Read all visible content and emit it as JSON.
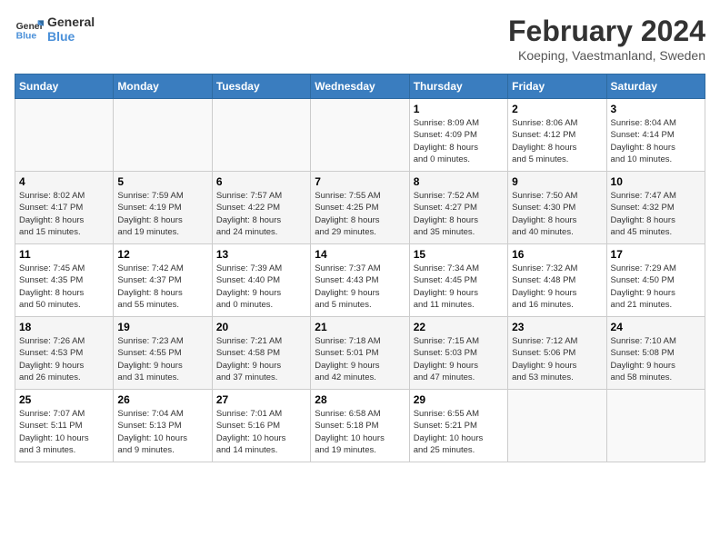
{
  "logo": {
    "text_general": "General",
    "text_blue": "Blue"
  },
  "title": "February 2024",
  "subtitle": "Koeping, Vaestmanland, Sweden",
  "weekdays": [
    "Sunday",
    "Monday",
    "Tuesday",
    "Wednesday",
    "Thursday",
    "Friday",
    "Saturday"
  ],
  "weeks": [
    [
      {
        "day": null,
        "info": null
      },
      {
        "day": null,
        "info": null
      },
      {
        "day": null,
        "info": null
      },
      {
        "day": null,
        "info": null
      },
      {
        "day": "1",
        "info": "Sunrise: 8:09 AM\nSunset: 4:09 PM\nDaylight: 8 hours\nand 0 minutes."
      },
      {
        "day": "2",
        "info": "Sunrise: 8:06 AM\nSunset: 4:12 PM\nDaylight: 8 hours\nand 5 minutes."
      },
      {
        "day": "3",
        "info": "Sunrise: 8:04 AM\nSunset: 4:14 PM\nDaylight: 8 hours\nand 10 minutes."
      }
    ],
    [
      {
        "day": "4",
        "info": "Sunrise: 8:02 AM\nSunset: 4:17 PM\nDaylight: 8 hours\nand 15 minutes."
      },
      {
        "day": "5",
        "info": "Sunrise: 7:59 AM\nSunset: 4:19 PM\nDaylight: 8 hours\nand 19 minutes."
      },
      {
        "day": "6",
        "info": "Sunrise: 7:57 AM\nSunset: 4:22 PM\nDaylight: 8 hours\nand 24 minutes."
      },
      {
        "day": "7",
        "info": "Sunrise: 7:55 AM\nSunset: 4:25 PM\nDaylight: 8 hours\nand 29 minutes."
      },
      {
        "day": "8",
        "info": "Sunrise: 7:52 AM\nSunset: 4:27 PM\nDaylight: 8 hours\nand 35 minutes."
      },
      {
        "day": "9",
        "info": "Sunrise: 7:50 AM\nSunset: 4:30 PM\nDaylight: 8 hours\nand 40 minutes."
      },
      {
        "day": "10",
        "info": "Sunrise: 7:47 AM\nSunset: 4:32 PM\nDaylight: 8 hours\nand 45 minutes."
      }
    ],
    [
      {
        "day": "11",
        "info": "Sunrise: 7:45 AM\nSunset: 4:35 PM\nDaylight: 8 hours\nand 50 minutes."
      },
      {
        "day": "12",
        "info": "Sunrise: 7:42 AM\nSunset: 4:37 PM\nDaylight: 8 hours\nand 55 minutes."
      },
      {
        "day": "13",
        "info": "Sunrise: 7:39 AM\nSunset: 4:40 PM\nDaylight: 9 hours\nand 0 minutes."
      },
      {
        "day": "14",
        "info": "Sunrise: 7:37 AM\nSunset: 4:43 PM\nDaylight: 9 hours\nand 5 minutes."
      },
      {
        "day": "15",
        "info": "Sunrise: 7:34 AM\nSunset: 4:45 PM\nDaylight: 9 hours\nand 11 minutes."
      },
      {
        "day": "16",
        "info": "Sunrise: 7:32 AM\nSunset: 4:48 PM\nDaylight: 9 hours\nand 16 minutes."
      },
      {
        "day": "17",
        "info": "Sunrise: 7:29 AM\nSunset: 4:50 PM\nDaylight: 9 hours\nand 21 minutes."
      }
    ],
    [
      {
        "day": "18",
        "info": "Sunrise: 7:26 AM\nSunset: 4:53 PM\nDaylight: 9 hours\nand 26 minutes."
      },
      {
        "day": "19",
        "info": "Sunrise: 7:23 AM\nSunset: 4:55 PM\nDaylight: 9 hours\nand 31 minutes."
      },
      {
        "day": "20",
        "info": "Sunrise: 7:21 AM\nSunset: 4:58 PM\nDaylight: 9 hours\nand 37 minutes."
      },
      {
        "day": "21",
        "info": "Sunrise: 7:18 AM\nSunset: 5:01 PM\nDaylight: 9 hours\nand 42 minutes."
      },
      {
        "day": "22",
        "info": "Sunrise: 7:15 AM\nSunset: 5:03 PM\nDaylight: 9 hours\nand 47 minutes."
      },
      {
        "day": "23",
        "info": "Sunrise: 7:12 AM\nSunset: 5:06 PM\nDaylight: 9 hours\nand 53 minutes."
      },
      {
        "day": "24",
        "info": "Sunrise: 7:10 AM\nSunset: 5:08 PM\nDaylight: 9 hours\nand 58 minutes."
      }
    ],
    [
      {
        "day": "25",
        "info": "Sunrise: 7:07 AM\nSunset: 5:11 PM\nDaylight: 10 hours\nand 3 minutes."
      },
      {
        "day": "26",
        "info": "Sunrise: 7:04 AM\nSunset: 5:13 PM\nDaylight: 10 hours\nand 9 minutes."
      },
      {
        "day": "27",
        "info": "Sunrise: 7:01 AM\nSunset: 5:16 PM\nDaylight: 10 hours\nand 14 minutes."
      },
      {
        "day": "28",
        "info": "Sunrise: 6:58 AM\nSunset: 5:18 PM\nDaylight: 10 hours\nand 19 minutes."
      },
      {
        "day": "29",
        "info": "Sunrise: 6:55 AM\nSunset: 5:21 PM\nDaylight: 10 hours\nand 25 minutes."
      },
      {
        "day": null,
        "info": null
      },
      {
        "day": null,
        "info": null
      }
    ]
  ]
}
